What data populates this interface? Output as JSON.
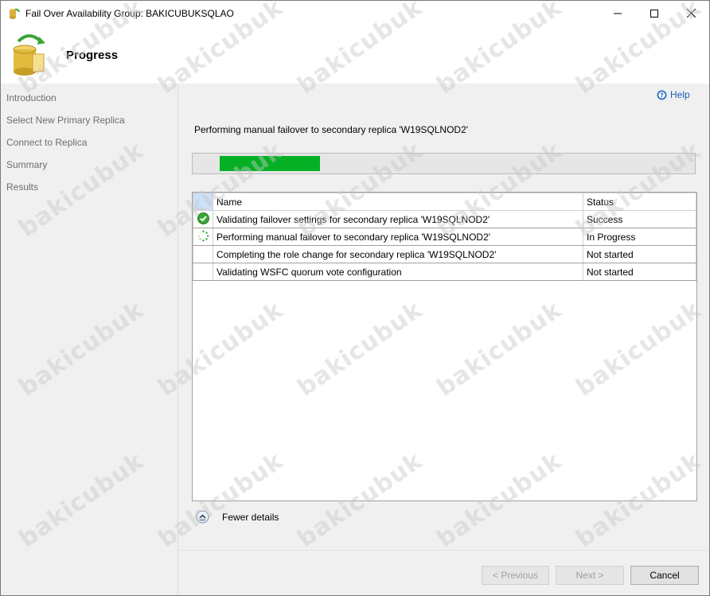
{
  "window": {
    "title": "Fail Over Availability Group: BAKICUBUKSQLAO",
    "buttons": {
      "minimize": "minimize-icon",
      "maximize": "maximize-icon",
      "close": "close-icon"
    }
  },
  "header": {
    "title": "Progress"
  },
  "sidebar": {
    "items": [
      {
        "label": "Introduction"
      },
      {
        "label": "Select New Primary Replica"
      },
      {
        "label": "Connect to Replica"
      },
      {
        "label": "Summary"
      },
      {
        "label": "Results"
      }
    ]
  },
  "content": {
    "help_label": "Help",
    "status_message": "Performing manual failover to secondary replica 'W19SQLNOD2'",
    "progress_fraction": 0.2,
    "grid": {
      "columns": [
        "Name",
        "Status"
      ],
      "rows": [
        {
          "icon": "success-check-icon",
          "name": "Validating failover settings for secondary replica 'W19SQLNOD2'",
          "status": "Success"
        },
        {
          "icon": "in-progress-spinner-icon",
          "name": "Performing manual failover to secondary replica 'W19SQLNOD2'",
          "status": "In Progress"
        },
        {
          "icon": "",
          "name": "Completing the role change for secondary replica 'W19SQLNOD2'",
          "status": "Not started"
        },
        {
          "icon": "",
          "name": "Validating WSFC quorum vote configuration",
          "status": "Not started"
        }
      ]
    },
    "details_toggle": "Fewer details"
  },
  "footer": {
    "previous": "< Previous",
    "next": "Next >",
    "cancel": "Cancel"
  },
  "watermark": "bakicubuk",
  "colors": {
    "progress_fill": "#06b025",
    "success": "#2f9e2f",
    "link": "#1a5fb4"
  }
}
